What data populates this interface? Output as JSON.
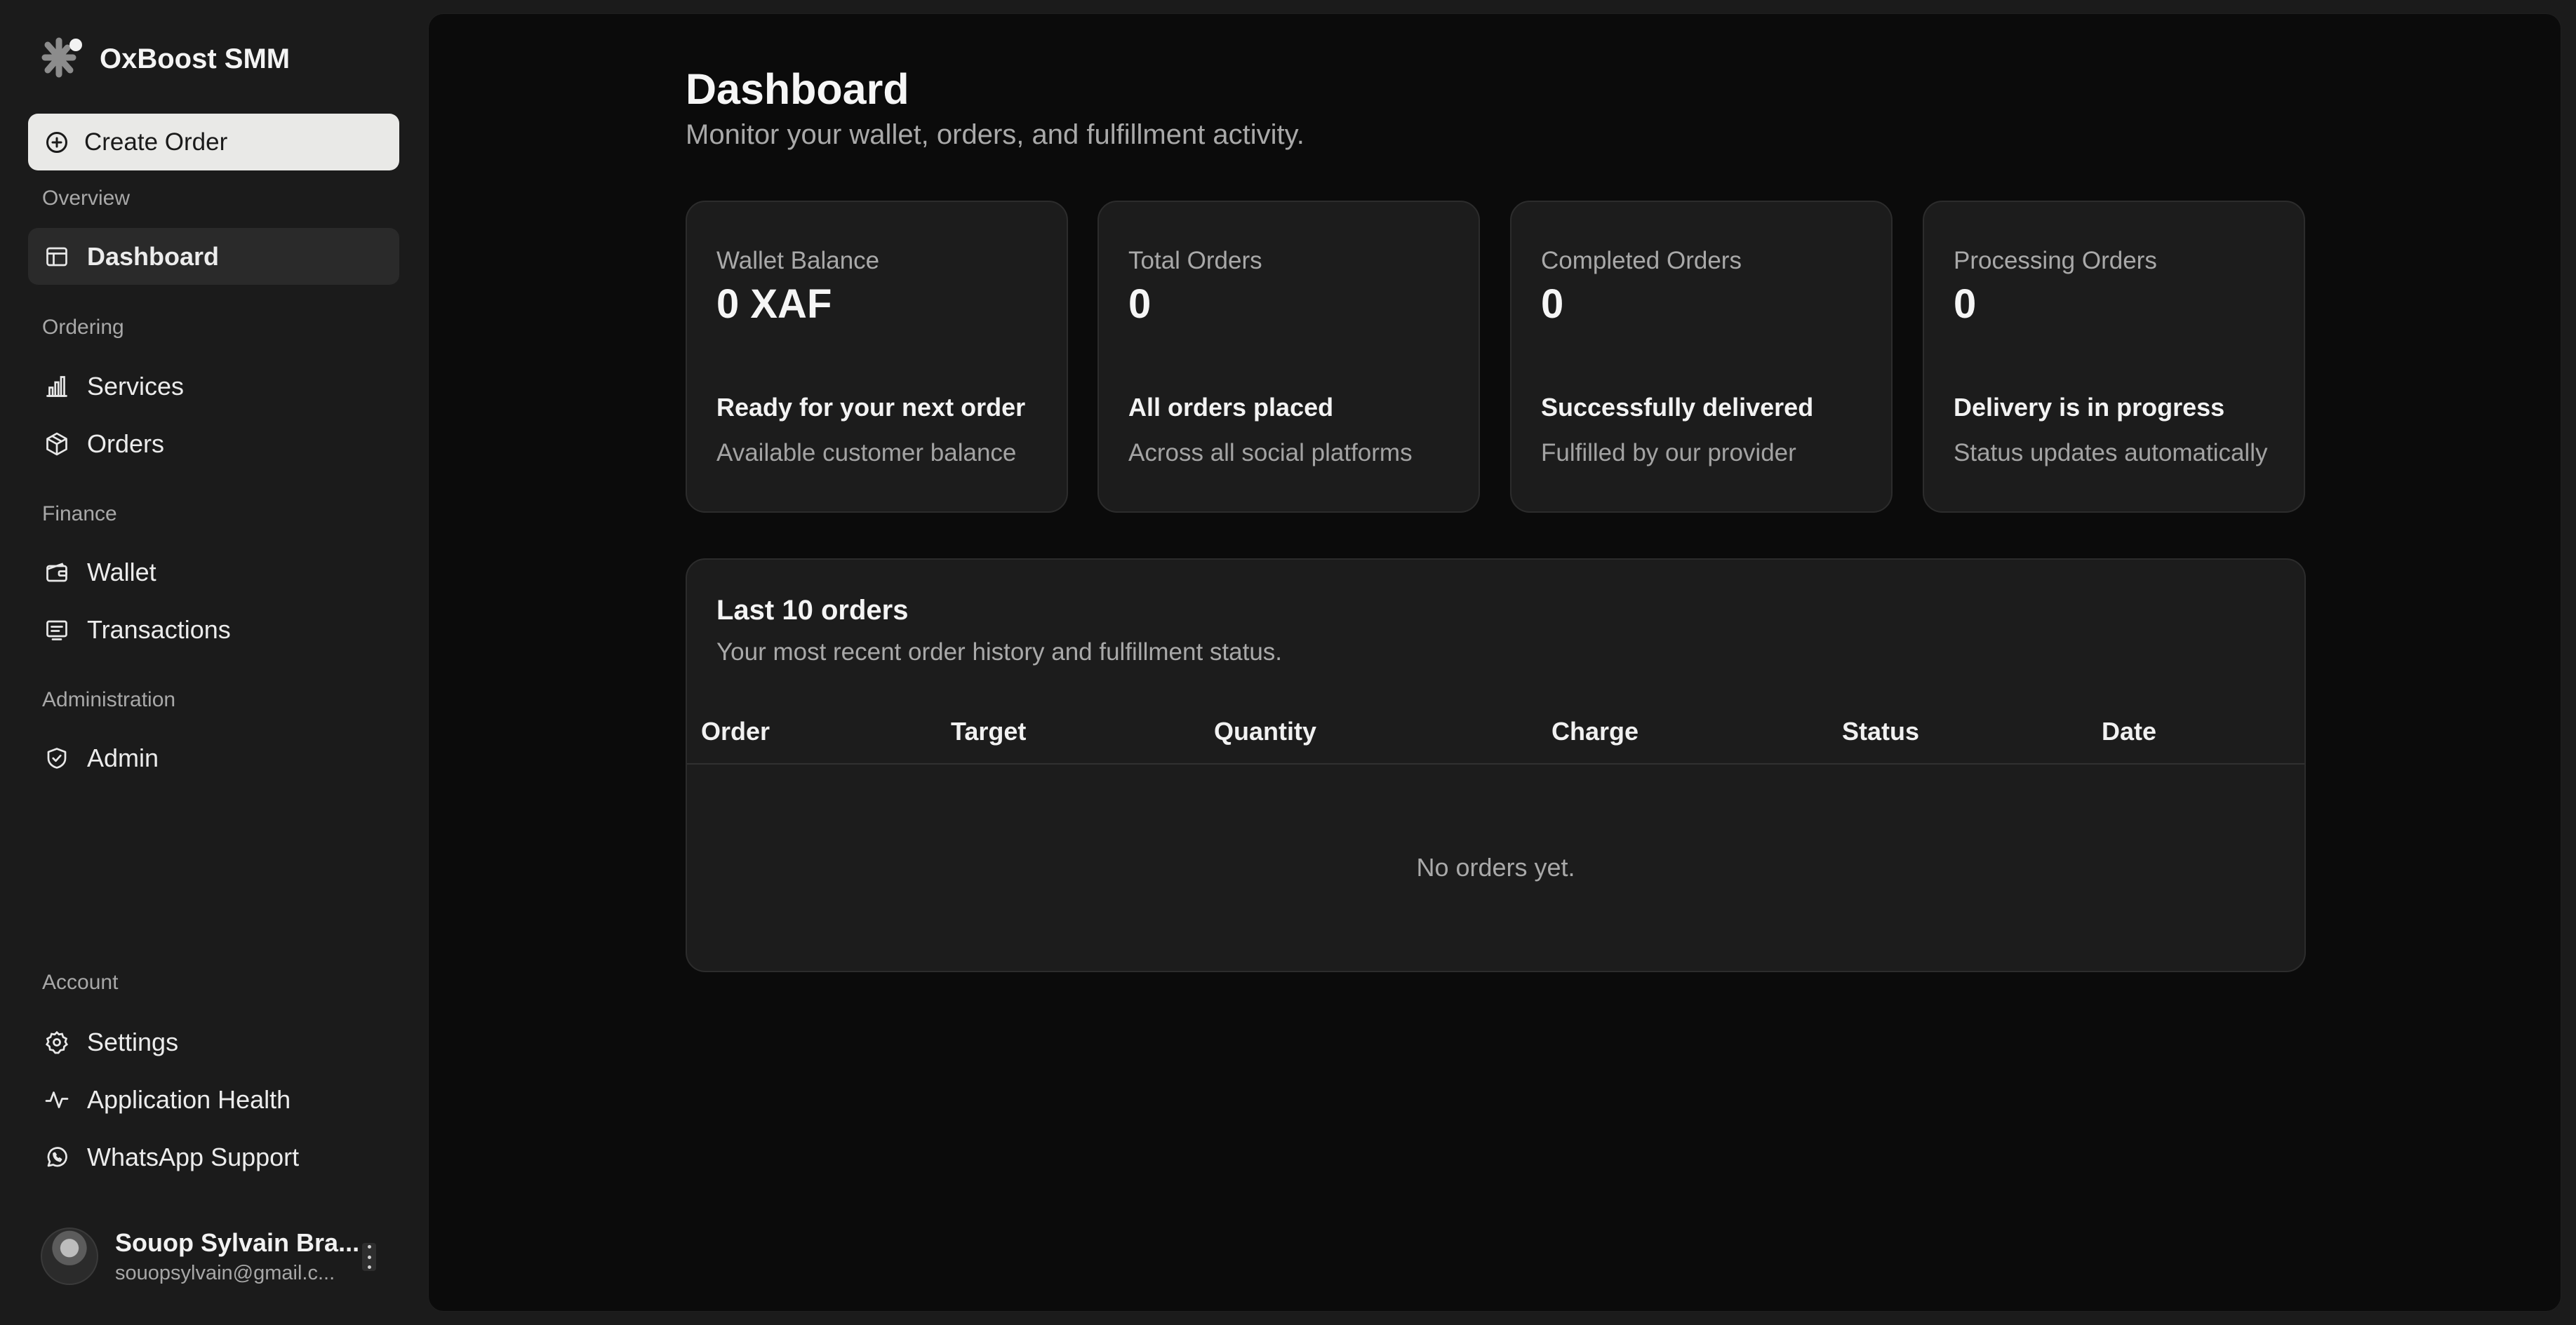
{
  "brand": {
    "name": "OxBoost SMM",
    "icon": "asterisk-logo-icon"
  },
  "sidebar": {
    "create_order": {
      "label": "Create Order",
      "icon": "plus-circle-icon"
    },
    "sections": {
      "overview": "Overview",
      "ordering": "Ordering",
      "finance": "Finance",
      "administration": "Administration",
      "account": "Account"
    },
    "items": {
      "dashboard": {
        "label": "Dashboard",
        "icon": "layout-icon",
        "active": true
      },
      "services": {
        "label": "Services",
        "icon": "bar-chart-icon"
      },
      "orders": {
        "label": "Orders",
        "icon": "package-icon"
      },
      "wallet": {
        "label": "Wallet",
        "icon": "wallet-icon"
      },
      "transactions": {
        "label": "Transactions",
        "icon": "receipt-icon"
      },
      "admin": {
        "label": "Admin",
        "icon": "shield-check-icon"
      },
      "settings": {
        "label": "Settings",
        "icon": "gear-icon"
      },
      "health": {
        "label": "Application Health",
        "icon": "activity-icon"
      },
      "whatsapp": {
        "label": "WhatsApp Support",
        "icon": "whatsapp-icon"
      }
    },
    "user": {
      "name": "Souop Sylvain Bra...",
      "email": "souopsylvain@gmail.c..."
    }
  },
  "main": {
    "title": "Dashboard",
    "subtitle": "Monitor your wallet, orders, and fulfillment activity.",
    "cards": [
      {
        "label": "Wallet Balance",
        "value": "0 XAF",
        "note": "Ready for your next order",
        "desc": "Available customer balance"
      },
      {
        "label": "Total Orders",
        "value": "0",
        "note": "All orders placed",
        "desc": "Across all social platforms"
      },
      {
        "label": "Completed Orders",
        "value": "0",
        "note": "Successfully delivered",
        "desc": "Fulfilled by our provider"
      },
      {
        "label": "Processing Orders",
        "value": "0",
        "note": "Delivery is in progress",
        "desc": "Status updates automatically"
      }
    ],
    "orders": {
      "title": "Last 10 orders",
      "subtitle": "Your most recent order history and fulfillment status.",
      "columns": [
        "Order",
        "Target",
        "Quantity",
        "Charge",
        "Status",
        "Date"
      ],
      "empty": "No orders yet."
    }
  },
  "colors": {
    "sidebar_bg": "#1b1b1b",
    "main_bg": "#0b0b0b",
    "card_bg": "#1c1c1c",
    "create_button_bg": "#e9e9e7"
  }
}
